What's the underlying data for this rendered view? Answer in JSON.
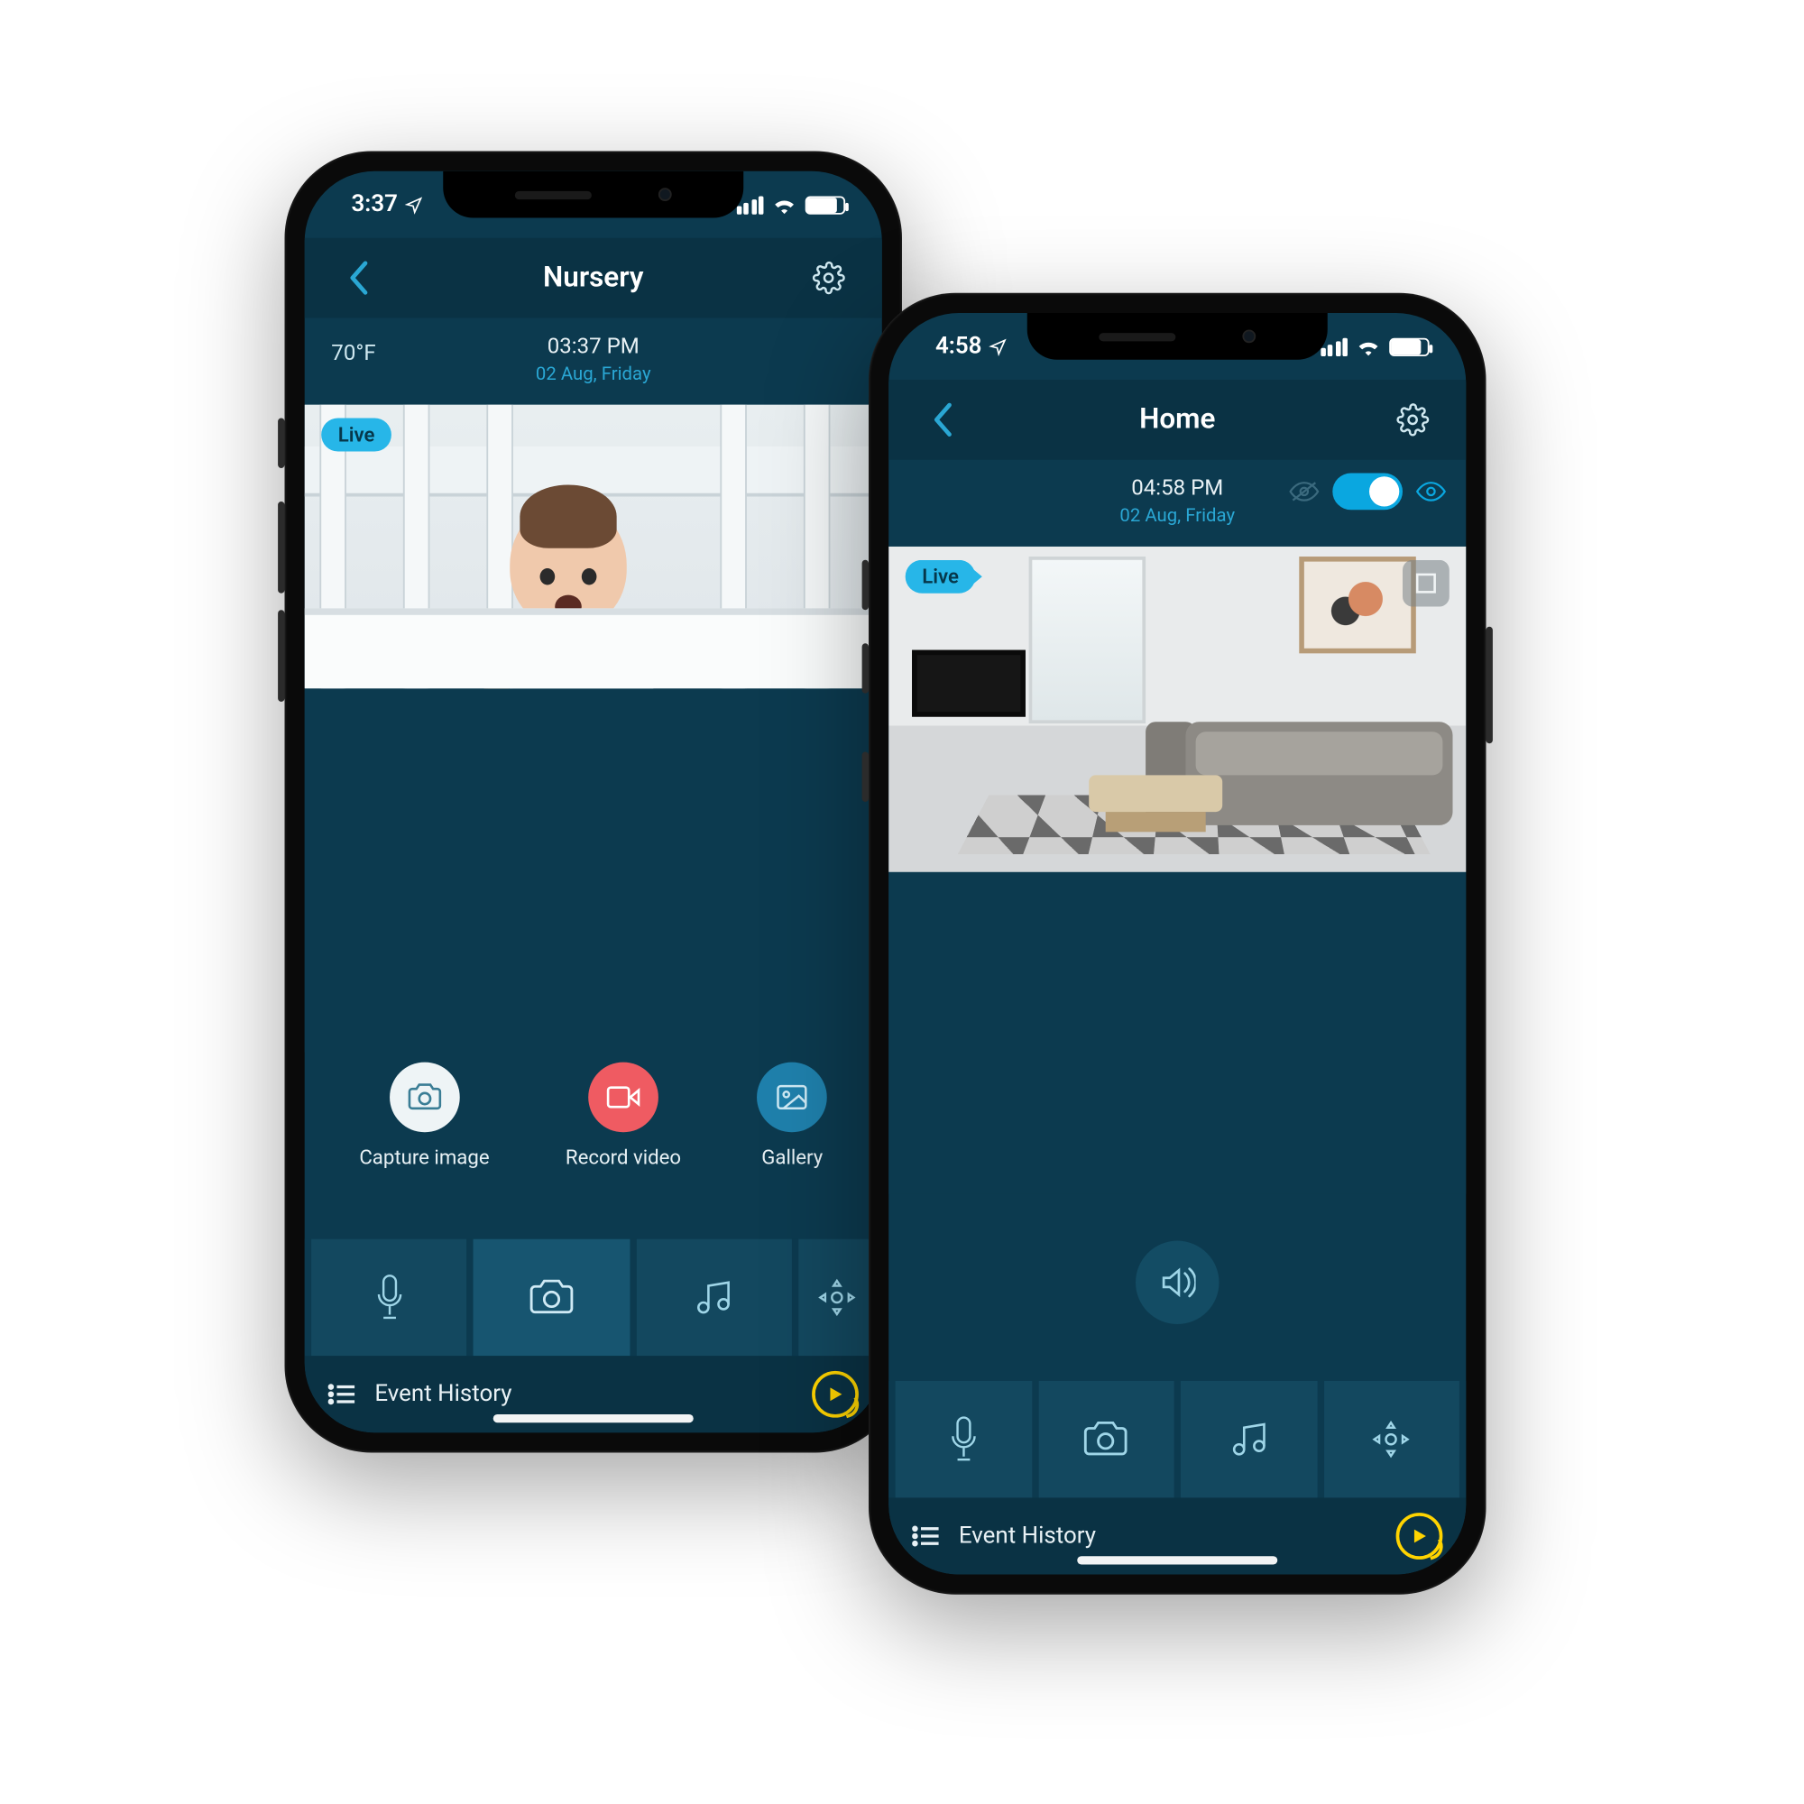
{
  "phones": {
    "left": {
      "status": {
        "time": "3:37"
      },
      "nav": {
        "title": "Nursery"
      },
      "meta": {
        "temp": "70°F",
        "time": "03:37 PM",
        "date": "02 Aug, Friday"
      },
      "live": "Live",
      "actions": {
        "capture": "Capture image",
        "record": "Record video",
        "gallery": "Gallery"
      },
      "eventHistory": "Event History"
    },
    "right": {
      "status": {
        "time": "4:58"
      },
      "nav": {
        "title": "Home"
      },
      "meta": {
        "time": "04:58 PM",
        "date": "02 Aug, Friday"
      },
      "live": "Live",
      "eventHistory": "Event History"
    }
  }
}
